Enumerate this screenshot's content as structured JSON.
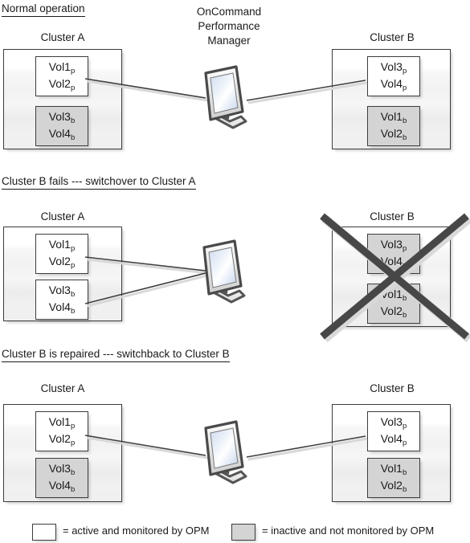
{
  "diagram": {
    "title_block": {
      "line1": "OnCommand",
      "line2": "Performance",
      "line3": "Manager"
    },
    "sections": [
      {
        "id": "normal",
        "heading": "Normal operation",
        "cluster_a_label": "Cluster A",
        "cluster_b_label": "Cluster B",
        "cluster_a_failed": false,
        "cluster_b_failed": false,
        "cluster_a_boxes": [
          {
            "state": "active",
            "line1": "Vol1",
            "sub1": "p",
            "line2": "Vol2",
            "sub2": "p"
          },
          {
            "state": "inactive",
            "line1": "Vol3",
            "sub1": "b",
            "line2": "Vol4",
            "sub2": "b"
          }
        ],
        "cluster_b_boxes": [
          {
            "state": "active",
            "line1": "Vol3",
            "sub1": "p",
            "line2": "Vol4",
            "sub2": "p"
          },
          {
            "state": "inactive",
            "line1": "Vol1",
            "sub1": "b",
            "line2": "Vol2",
            "sub2": "b"
          }
        ]
      },
      {
        "id": "switchover",
        "heading": "Cluster B fails --- switchover to Cluster A",
        "cluster_a_label": "Cluster A",
        "cluster_b_label": "Cluster B",
        "cluster_a_failed": false,
        "cluster_b_failed": true,
        "cluster_a_boxes": [
          {
            "state": "active",
            "line1": "Vol1",
            "sub1": "p",
            "line2": "Vol2",
            "sub2": "p"
          },
          {
            "state": "active",
            "line1": "Vol3",
            "sub1": "b",
            "line2": "Vol4",
            "sub2": "b"
          }
        ],
        "cluster_b_boxes": [
          {
            "state": "inactive",
            "line1": "Vol3",
            "sub1": "p",
            "line2": "Vol4",
            "sub2": "p"
          },
          {
            "state": "inactive",
            "line1": "Vol1",
            "sub1": "b",
            "line2": "Vol2",
            "sub2": "b"
          }
        ]
      },
      {
        "id": "switchback",
        "heading": "Cluster B is repaired --- switchback to Cluster B",
        "cluster_a_label": "Cluster A",
        "cluster_b_label": "Cluster B",
        "cluster_a_failed": false,
        "cluster_b_failed": false,
        "cluster_a_boxes": [
          {
            "state": "active",
            "line1": "Vol1",
            "sub1": "p",
            "line2": "Vol2",
            "sub2": "p"
          },
          {
            "state": "inactive",
            "line1": "Vol3",
            "sub1": "b",
            "line2": "Vol4",
            "sub2": "b"
          }
        ],
        "cluster_b_boxes": [
          {
            "state": "active",
            "line1": "Vol3",
            "sub1": "p",
            "line2": "Vol4",
            "sub2": "p"
          },
          {
            "state": "inactive",
            "line1": "Vol1",
            "sub1": "b",
            "line2": "Vol2",
            "sub2": "b"
          }
        ]
      }
    ],
    "legend": {
      "active_text": "= active and monitored by OPM",
      "inactive_text": "= inactive and not monitored by OPM"
    },
    "colors": {
      "active_fill": "#ffffff",
      "inactive_fill": "#d4d4d4",
      "border": "#3c3c3c",
      "text": "#1a1a1a",
      "connector": "#3f3f3f",
      "failure_x": "#474747",
      "screen_light": "#ffffff",
      "screen_tint": "#c8d8ee"
    }
  }
}
